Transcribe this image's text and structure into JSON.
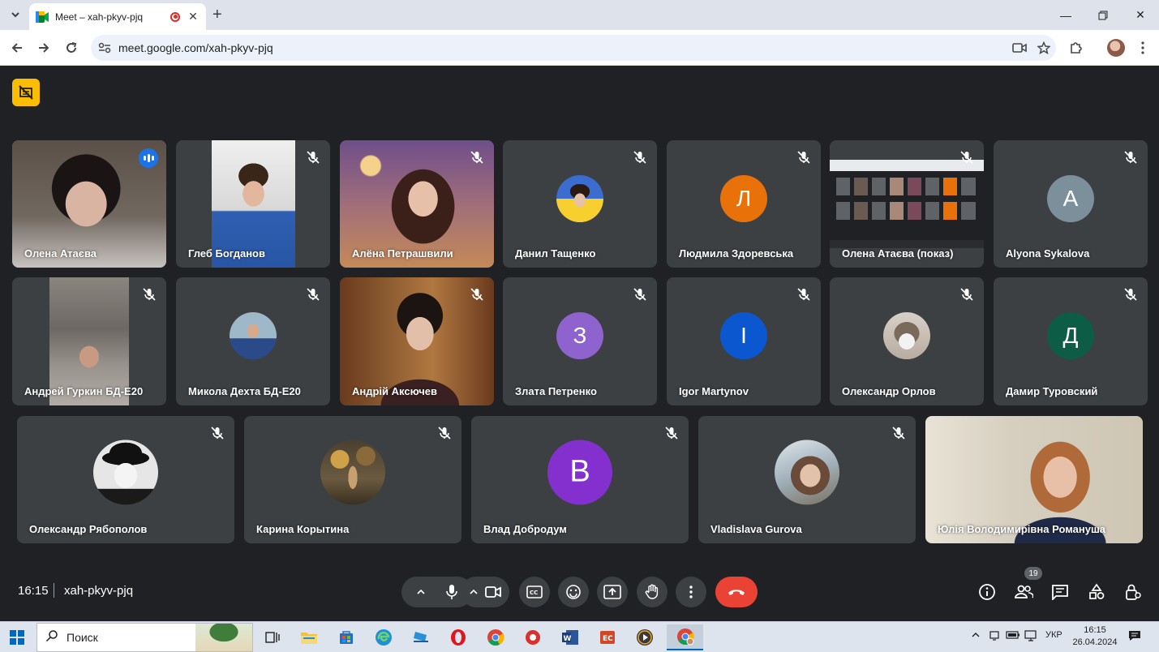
{
  "browser": {
    "tab_title": "Meet – xah-pkyv-pjq",
    "url": "meet.google.com/xah-pkyv-pjq"
  },
  "tiles": [
    {
      "name": "Олена Атаєва",
      "kind": "video",
      "speaking": true
    },
    {
      "name": "Глеб Богданов",
      "kind": "video"
    },
    {
      "name": "Алёна Петрашвили",
      "kind": "video"
    },
    {
      "name": "Данил Тащенко",
      "kind": "photo"
    },
    {
      "name": "Людмила Здоревська",
      "kind": "letter",
      "letter": "Л",
      "color": "#e8710a"
    },
    {
      "name": "Олена Атаєва (показ)",
      "kind": "screen"
    },
    {
      "name": "Alyona Sykalova",
      "kind": "letter",
      "letter": "A",
      "color": "#7b909a"
    },
    {
      "name": "Андрей Гуркин БД-Е20",
      "kind": "video"
    },
    {
      "name": "Микола Дехта БД-Е20",
      "kind": "photo"
    },
    {
      "name": "Андрій Аксючев",
      "kind": "video"
    },
    {
      "name": "Злата Петренко",
      "kind": "letter",
      "letter": "З",
      "color": "#8e63ce"
    },
    {
      "name": "Igor Martynov",
      "kind": "letter",
      "letter": "I",
      "color": "#0b57d0"
    },
    {
      "name": "Олександр Орлов",
      "kind": "photo"
    },
    {
      "name": "Дамир Туровский",
      "kind": "letter",
      "letter": "Д",
      "color": "#0d5c46"
    },
    {
      "name": "Олександр Рябополов",
      "kind": "photo"
    },
    {
      "name": "Карина Корытина",
      "kind": "photo"
    },
    {
      "name": "Влад Добродум",
      "kind": "letter",
      "letter": "В",
      "color": "#8430ce"
    },
    {
      "name": "Vladislava Gurova",
      "kind": "photo"
    },
    {
      "name": "Юлія Володимирівна Романуша",
      "kind": "video"
    }
  ],
  "meeting": {
    "time": "16:15",
    "code": "xah-pkyv-pjq",
    "participants_count": "19"
  },
  "taskbar": {
    "search_placeholder": "Поиск",
    "language": "УКР",
    "clock_time": "16:15",
    "clock_date": "26.04.2024"
  }
}
